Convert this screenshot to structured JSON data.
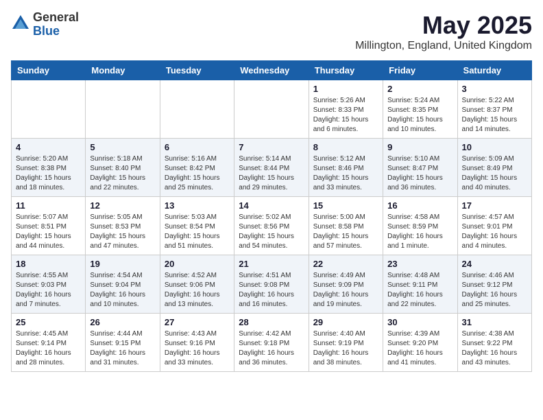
{
  "logo": {
    "general": "General",
    "blue": "Blue"
  },
  "title": "May 2025",
  "subtitle": "Millington, England, United Kingdom",
  "weekdays": [
    "Sunday",
    "Monday",
    "Tuesday",
    "Wednesday",
    "Thursday",
    "Friday",
    "Saturday"
  ],
  "weeks": [
    [
      {
        "day": "",
        "info": ""
      },
      {
        "day": "",
        "info": ""
      },
      {
        "day": "",
        "info": ""
      },
      {
        "day": "",
        "info": ""
      },
      {
        "day": "1",
        "info": "Sunrise: 5:26 AM\nSunset: 8:33 PM\nDaylight: 15 hours\nand 6 minutes."
      },
      {
        "day": "2",
        "info": "Sunrise: 5:24 AM\nSunset: 8:35 PM\nDaylight: 15 hours\nand 10 minutes."
      },
      {
        "day": "3",
        "info": "Sunrise: 5:22 AM\nSunset: 8:37 PM\nDaylight: 15 hours\nand 14 minutes."
      }
    ],
    [
      {
        "day": "4",
        "info": "Sunrise: 5:20 AM\nSunset: 8:38 PM\nDaylight: 15 hours\nand 18 minutes."
      },
      {
        "day": "5",
        "info": "Sunrise: 5:18 AM\nSunset: 8:40 PM\nDaylight: 15 hours\nand 22 minutes."
      },
      {
        "day": "6",
        "info": "Sunrise: 5:16 AM\nSunset: 8:42 PM\nDaylight: 15 hours\nand 25 minutes."
      },
      {
        "day": "7",
        "info": "Sunrise: 5:14 AM\nSunset: 8:44 PM\nDaylight: 15 hours\nand 29 minutes."
      },
      {
        "day": "8",
        "info": "Sunrise: 5:12 AM\nSunset: 8:46 PM\nDaylight: 15 hours\nand 33 minutes."
      },
      {
        "day": "9",
        "info": "Sunrise: 5:10 AM\nSunset: 8:47 PM\nDaylight: 15 hours\nand 36 minutes."
      },
      {
        "day": "10",
        "info": "Sunrise: 5:09 AM\nSunset: 8:49 PM\nDaylight: 15 hours\nand 40 minutes."
      }
    ],
    [
      {
        "day": "11",
        "info": "Sunrise: 5:07 AM\nSunset: 8:51 PM\nDaylight: 15 hours\nand 44 minutes."
      },
      {
        "day": "12",
        "info": "Sunrise: 5:05 AM\nSunset: 8:53 PM\nDaylight: 15 hours\nand 47 minutes."
      },
      {
        "day": "13",
        "info": "Sunrise: 5:03 AM\nSunset: 8:54 PM\nDaylight: 15 hours\nand 51 minutes."
      },
      {
        "day": "14",
        "info": "Sunrise: 5:02 AM\nSunset: 8:56 PM\nDaylight: 15 hours\nand 54 minutes."
      },
      {
        "day": "15",
        "info": "Sunrise: 5:00 AM\nSunset: 8:58 PM\nDaylight: 15 hours\nand 57 minutes."
      },
      {
        "day": "16",
        "info": "Sunrise: 4:58 AM\nSunset: 8:59 PM\nDaylight: 16 hours\nand 1 minute."
      },
      {
        "day": "17",
        "info": "Sunrise: 4:57 AM\nSunset: 9:01 PM\nDaylight: 16 hours\nand 4 minutes."
      }
    ],
    [
      {
        "day": "18",
        "info": "Sunrise: 4:55 AM\nSunset: 9:03 PM\nDaylight: 16 hours\nand 7 minutes."
      },
      {
        "day": "19",
        "info": "Sunrise: 4:54 AM\nSunset: 9:04 PM\nDaylight: 16 hours\nand 10 minutes."
      },
      {
        "day": "20",
        "info": "Sunrise: 4:52 AM\nSunset: 9:06 PM\nDaylight: 16 hours\nand 13 minutes."
      },
      {
        "day": "21",
        "info": "Sunrise: 4:51 AM\nSunset: 9:08 PM\nDaylight: 16 hours\nand 16 minutes."
      },
      {
        "day": "22",
        "info": "Sunrise: 4:49 AM\nSunset: 9:09 PM\nDaylight: 16 hours\nand 19 minutes."
      },
      {
        "day": "23",
        "info": "Sunrise: 4:48 AM\nSunset: 9:11 PM\nDaylight: 16 hours\nand 22 minutes."
      },
      {
        "day": "24",
        "info": "Sunrise: 4:46 AM\nSunset: 9:12 PM\nDaylight: 16 hours\nand 25 minutes."
      }
    ],
    [
      {
        "day": "25",
        "info": "Sunrise: 4:45 AM\nSunset: 9:14 PM\nDaylight: 16 hours\nand 28 minutes."
      },
      {
        "day": "26",
        "info": "Sunrise: 4:44 AM\nSunset: 9:15 PM\nDaylight: 16 hours\nand 31 minutes."
      },
      {
        "day": "27",
        "info": "Sunrise: 4:43 AM\nSunset: 9:16 PM\nDaylight: 16 hours\nand 33 minutes."
      },
      {
        "day": "28",
        "info": "Sunrise: 4:42 AM\nSunset: 9:18 PM\nDaylight: 16 hours\nand 36 minutes."
      },
      {
        "day": "29",
        "info": "Sunrise: 4:40 AM\nSunset: 9:19 PM\nDaylight: 16 hours\nand 38 minutes."
      },
      {
        "day": "30",
        "info": "Sunrise: 4:39 AM\nSunset: 9:20 PM\nDaylight: 16 hours\nand 41 minutes."
      },
      {
        "day": "31",
        "info": "Sunrise: 4:38 AM\nSunset: 9:22 PM\nDaylight: 16 hours\nand 43 minutes."
      }
    ]
  ]
}
